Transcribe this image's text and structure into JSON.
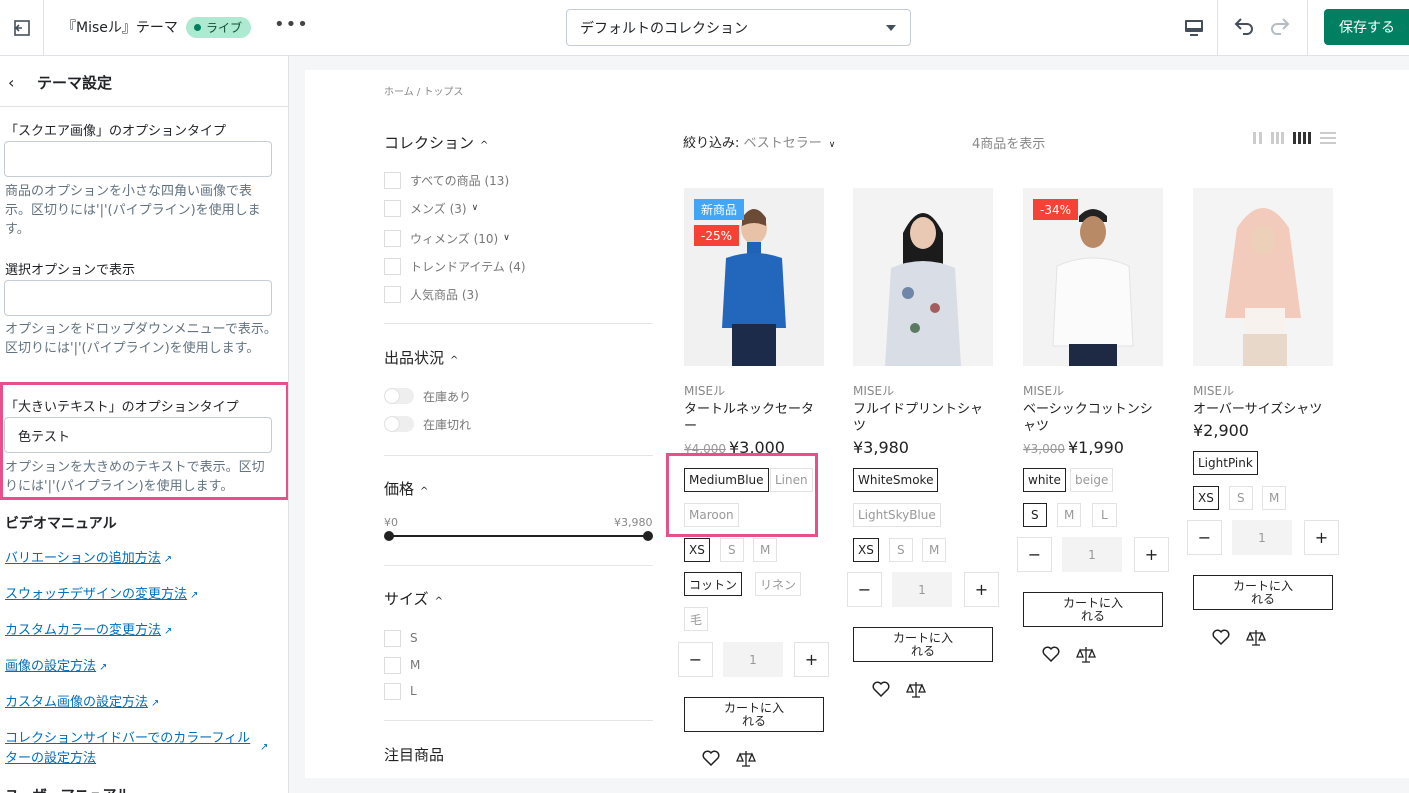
{
  "topbar": {
    "theme_name": "『Miseル』テーマ",
    "live_label": "ライブ",
    "more_label": "•••",
    "collection_select": "デフォルトのコレクション",
    "save_label": "保存する"
  },
  "sidebar": {
    "title": "テーマ設定",
    "fields": [
      {
        "label": "「スクエア画像」のオプションタイプ",
        "value": "",
        "help": "商品のオプションを小さな四角い画像で表示。区切りには'|'(パイプライン)を使用します。"
      },
      {
        "label": "選択オプションで表示",
        "value": "",
        "help": "オプションをドロップダウンメニューで表示。区切りには'|'(パイプライン)を使用します。"
      },
      {
        "label": "「大きいテキスト」のオプションタイプ",
        "value": "色テスト",
        "help": "オプションを大きめのテキストで表示。区切りには'|'(パイプライン)を使用します。"
      }
    ],
    "video_section_title": "ビデオマニュアル",
    "links": [
      "バリエーションの追加方法",
      "スウォッチデザインの変更方法",
      "カスタムカラーの変更方法",
      "画像の設定方法",
      "カスタム画像の設定方法",
      "コレクションサイドバーでのカラーフィルターの設定方法"
    ],
    "user_manual_title": "ユーザーマニュアル"
  },
  "preview": {
    "breadcrumb": "ホーム / トップス",
    "filters": {
      "collection_title": "コレクション",
      "collection_items": [
        "すべての商品 (13)",
        "メンズ (3)",
        "ウィメンズ (10)",
        "トレンドアイテム (4)",
        "人気商品 (3)"
      ],
      "stock_title": "出品状況",
      "stock_items": [
        "在庫あり",
        "在庫切れ"
      ],
      "price_title": "価格",
      "price_min": "¥0",
      "price_max": "¥3,980",
      "size_title": "サイズ",
      "size_items": [
        "S",
        "M",
        "L"
      ],
      "featured_title": "注目商品"
    },
    "sort_label": "絞り込み:",
    "sort_value": "ベストセラー",
    "count": "4商品を表示",
    "products": [
      {
        "brand": "MISEル",
        "name": "タートルネックセーター",
        "old_price": "¥4,000",
        "price": "¥3,000",
        "badges": [
          "新商品",
          "-25%"
        ],
        "colors": [
          "MediumBlue",
          "Linen",
          "Maroon"
        ],
        "sizes": [
          "XS",
          "S",
          "M"
        ],
        "materials": [
          "コットン",
          "リネン",
          "毛"
        ],
        "qty": "1",
        "cart_label": "カートに入れる"
      },
      {
        "brand": "MISEル",
        "name": "フルイドプリントシャツ",
        "price": "¥3,980",
        "colors": [
          "WhiteSmoke",
          "LightSkyBlue"
        ],
        "sizes": [
          "XS",
          "S",
          "M"
        ],
        "qty": "1",
        "cart_label": "カートに入れる"
      },
      {
        "brand": "MISEル",
        "name": "ベーシックコットンシャツ",
        "old_price": "¥3,000",
        "price": "¥1,990",
        "badges": [
          "-34%"
        ],
        "colors": [
          "white",
          "beige"
        ],
        "sizes": [
          "S",
          "M",
          "L"
        ],
        "qty": "1",
        "cart_label": "カートに入れる"
      },
      {
        "brand": "MISEル",
        "name": "オーバーサイズシャツ",
        "price": "¥2,900",
        "colors": [
          "LightPink"
        ],
        "sizes": [
          "XS",
          "S",
          "M"
        ],
        "qty": "1",
        "cart_label": "カートに入れる"
      }
    ]
  },
  "colors": {
    "accent": "#008060",
    "highlight": "#e8508c",
    "link": "#006fbb",
    "badge_new": "#42a5f5",
    "badge_sale": "#f44336"
  }
}
